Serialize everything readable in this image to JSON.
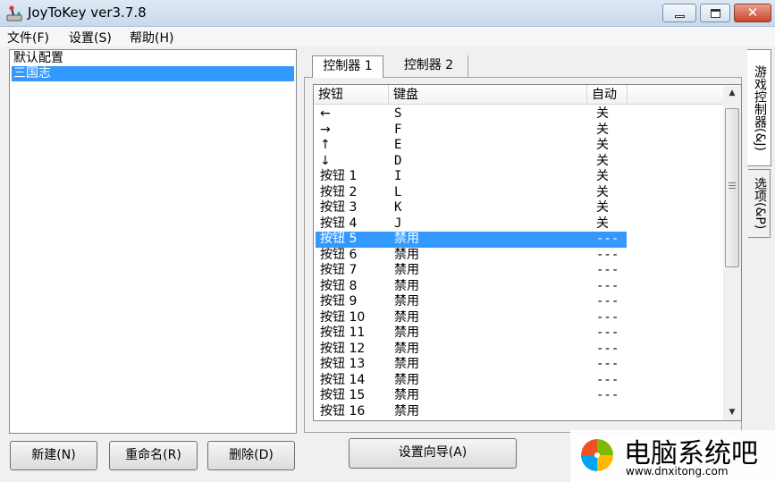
{
  "window": {
    "title": "JoyToKey ver3.7.8",
    "close_glyph": "✕",
    "app_icon": "joystick-icon"
  },
  "menu": [
    {
      "label": "文件(F)"
    },
    {
      "label": "设置(S)"
    },
    {
      "label": "帮助(H)"
    }
  ],
  "profiles": {
    "items": [
      {
        "label": "默认配置",
        "selected": false
      },
      {
        "label": "三国志",
        "selected": true
      }
    ]
  },
  "buttons": {
    "new": "新建(N)",
    "rename": "重命名(R)",
    "delete": "删除(D)",
    "wizard": "设置向导(A)"
  },
  "tabs": [
    {
      "label": "控制器 1",
      "active": true
    },
    {
      "label": "控制器 2",
      "active": false
    }
  ],
  "side_tabs": [
    {
      "label": "游戏控制器(&J)",
      "active": true
    },
    {
      "label": "选项(&P)",
      "active": false
    }
  ],
  "table": {
    "headers": {
      "button": "按钮",
      "key": "键盘",
      "auto": "自动"
    },
    "rows": [
      {
        "button": "←",
        "key": "S",
        "auto": "关"
      },
      {
        "button": "→",
        "key": "F",
        "auto": "关"
      },
      {
        "button": "↑",
        "key": "E",
        "auto": "关"
      },
      {
        "button": "↓",
        "key": "D",
        "auto": "关"
      },
      {
        "button": "按钮 1",
        "key": "I",
        "auto": "关"
      },
      {
        "button": "按钮 2",
        "key": "L",
        "auto": "关"
      },
      {
        "button": "按钮 3",
        "key": "K",
        "auto": "关"
      },
      {
        "button": "按钮 4",
        "key": "J",
        "auto": "关"
      },
      {
        "button": "按钮 5",
        "key": "禁用",
        "auto": "---",
        "selected": true
      },
      {
        "button": "按钮 6",
        "key": "禁用",
        "auto": "---"
      },
      {
        "button": "按钮 7",
        "key": "禁用",
        "auto": "---"
      },
      {
        "button": "按钮 8",
        "key": "禁用",
        "auto": "---"
      },
      {
        "button": "按钮 9",
        "key": "禁用",
        "auto": "---"
      },
      {
        "button": "按钮 10",
        "key": "禁用",
        "auto": "---"
      },
      {
        "button": "按钮 11",
        "key": "禁用",
        "auto": "---"
      },
      {
        "button": "按钮 12",
        "key": "禁用",
        "auto": "---"
      },
      {
        "button": "按钮 13",
        "key": "禁用",
        "auto": "---"
      },
      {
        "button": "按钮 14",
        "key": "禁用",
        "auto": "---"
      },
      {
        "button": "按钮 15",
        "key": "禁用",
        "auto": "---"
      },
      {
        "button": "按钮 16",
        "key": "禁用",
        "auto": ""
      }
    ]
  },
  "scrollbar": {
    "up": "▲",
    "down": "▼"
  },
  "watermark": {
    "title": "电脑系统吧",
    "url": "www.dnxitong.com",
    "logo": "windows-logo-icon"
  },
  "colors": {
    "selection": "#3399ff",
    "title_gradient_top": "#dfe9f5",
    "close_button": "#c8462b"
  }
}
